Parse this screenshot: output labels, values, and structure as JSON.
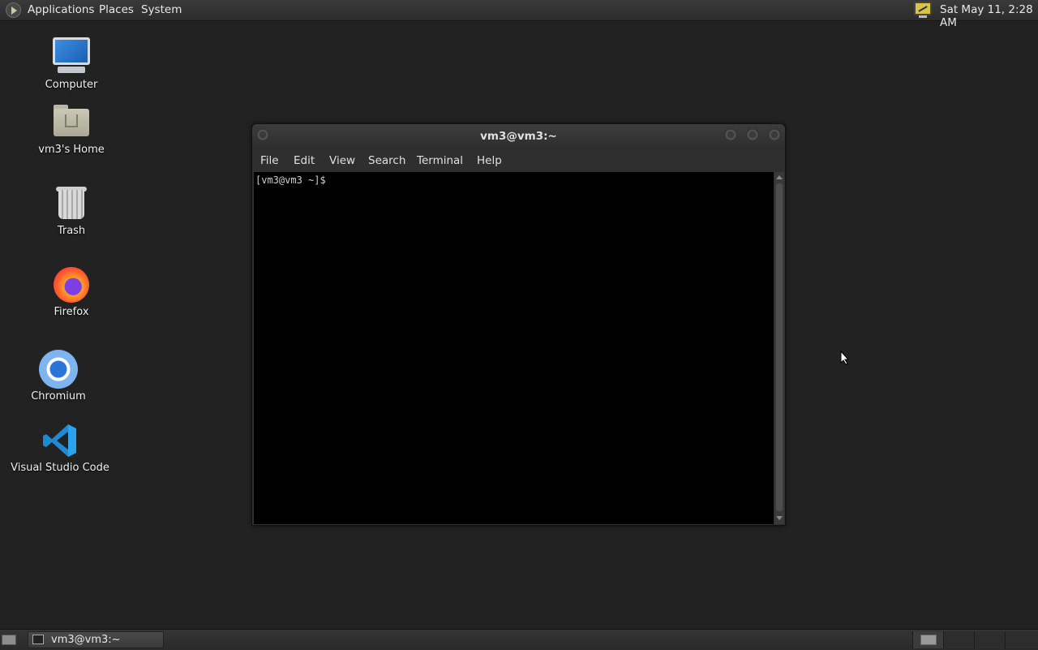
{
  "top_panel": {
    "menus": [
      "Applications",
      "Places",
      "System"
    ],
    "clock": "Sat May 11,  2:28 AM"
  },
  "desktop": {
    "icons": [
      {
        "label": "Computer",
        "icon": "computer-icon"
      },
      {
        "label": "vm3's Home",
        "icon": "home-folder-icon"
      },
      {
        "label": "Trash",
        "icon": "trash-icon"
      },
      {
        "label": "Firefox",
        "icon": "firefox-icon"
      },
      {
        "label": "Chromium",
        "icon": "chromium-icon"
      },
      {
        "label": "Visual Studio Code",
        "icon": "vscode-icon"
      }
    ]
  },
  "terminal": {
    "title": "vm3@vm3:~",
    "menus": [
      "File",
      "Edit",
      "View",
      "Search",
      "Terminal",
      "Help"
    ],
    "prompt": "[vm3@vm3 ~]$"
  },
  "bottom_panel": {
    "task_label": "vm3@vm3:~"
  },
  "colors": {
    "desktop_bg": "#222222",
    "panel_bg": "#333333",
    "terminal_bg": "#000000"
  }
}
